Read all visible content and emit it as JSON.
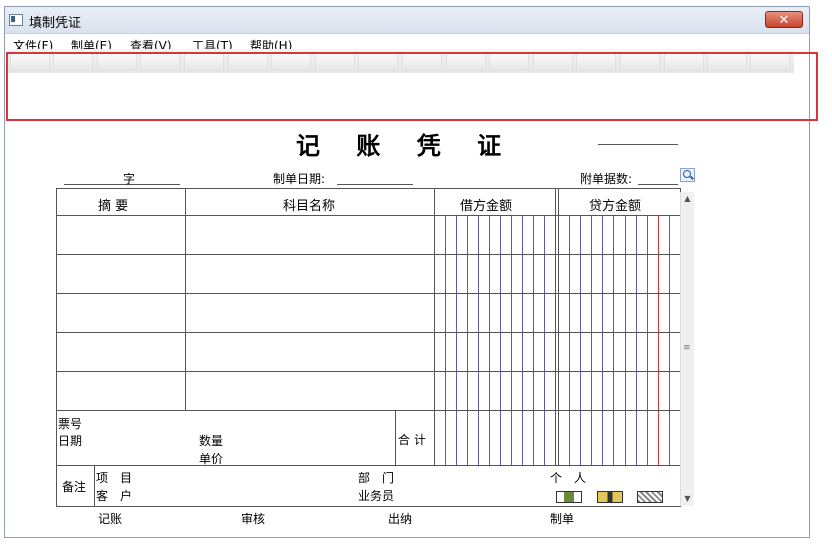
{
  "window": {
    "title": "填制凭证",
    "close_label": "✕"
  },
  "menu": [
    {
      "label": "文件(F)"
    },
    {
      "label": "制单(E)"
    },
    {
      "label": "查看(V)"
    },
    {
      "label": "工具(T)"
    },
    {
      "label": "帮助(H)"
    }
  ],
  "voucher": {
    "title": "记 账 凭 证",
    "word_label": "字",
    "date_label": "制单日期:",
    "attachments_label": "附单据数:",
    "columns": {
      "summary": "摘 要",
      "account": "科目名称",
      "debit": "借方金额",
      "credit": "贷方金额"
    },
    "footer": {
      "ticket_no": "票号",
      "date": "日期",
      "quantity": "数量",
      "unit_price": "单价",
      "total": "合 计",
      "remarks": "备注",
      "project": "项　目",
      "customer": "客　户",
      "department": "部　门",
      "salesperson": "业务员",
      "individual": "个　人"
    },
    "signatures": {
      "bookkeeper": "记账",
      "auditor": "审核",
      "cashier": "出纳",
      "preparer": "制单"
    }
  },
  "colors": {
    "grid_line": "#555555",
    "digit_line": "#5b5bb3",
    "unit_line": "#cc3333",
    "highlight": "#d9353a"
  }
}
